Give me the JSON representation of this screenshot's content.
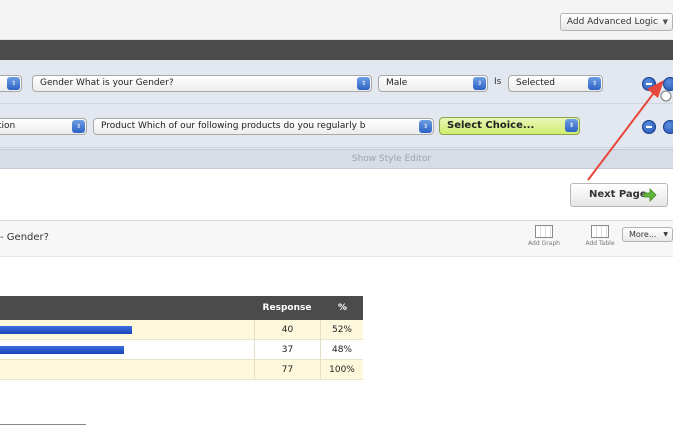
{
  "top": {
    "advanced_logic_label": "Add Advanced Logic"
  },
  "logic": {
    "row1": {
      "question_select": "Gender What is your Gender?",
      "answer_select": "Male",
      "is_label": "Is",
      "state_select": "Selected"
    },
    "row2": {
      "left_select": "tion",
      "question_select": "Product Which of our following products do you regularly b",
      "choice_select": "Select Choice..."
    }
  },
  "style_editor_label": "Show Style Editor",
  "next_page_label": "Next Page",
  "question": {
    "title": "- Gender?",
    "tools": [
      {
        "label": "Add Graph",
        "icon": "graph-icon"
      },
      {
        "label": "Add Table",
        "icon": "table-icon"
      }
    ],
    "more_label": "More..."
  },
  "results": {
    "headers": [
      "Response",
      "%"
    ],
    "rows": [
      {
        "bar_percent": 52,
        "response": "40",
        "percent": "52%"
      },
      {
        "bar_percent": 48,
        "response": "37",
        "percent": "48%"
      },
      {
        "bar_percent": 0,
        "response": "77",
        "percent": "100%"
      }
    ]
  },
  "colors": {
    "accent_blue": "#2d62c4",
    "bar_blue": "#1a44b8",
    "arrow_red": "#e8473c",
    "row_tint": "#fdf8dc",
    "header_dark": "#4b4b4b"
  }
}
